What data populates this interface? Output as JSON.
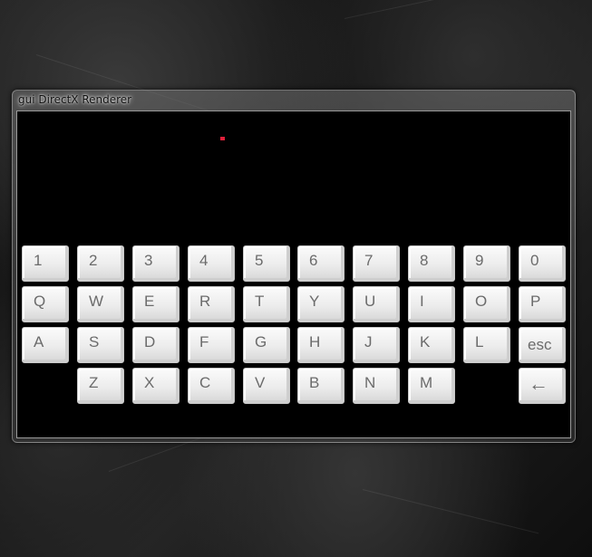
{
  "window": {
    "title": "gui   DirectX Renderer"
  },
  "keyboard": {
    "rows": [
      {
        "keys": [
          "1",
          "2",
          "3",
          "4",
          "5",
          "6",
          "7",
          "8",
          "9",
          "0"
        ]
      },
      {
        "keys": [
          "Q",
          "W",
          "E",
          "R",
          "T",
          "Y",
          "U",
          "I",
          "O",
          "P"
        ]
      },
      {
        "keys": [
          "A",
          "S",
          "D",
          "F",
          "G",
          "H",
          "J",
          "K",
          "L",
          "esc"
        ]
      },
      {
        "keys": [
          "Z",
          "X",
          "C",
          "V",
          "B",
          "N",
          "M",
          "←"
        ]
      }
    ]
  },
  "colors": {
    "cursor": "#e0203a",
    "key_text": "#6b6b6b",
    "client_background": "#000000"
  }
}
